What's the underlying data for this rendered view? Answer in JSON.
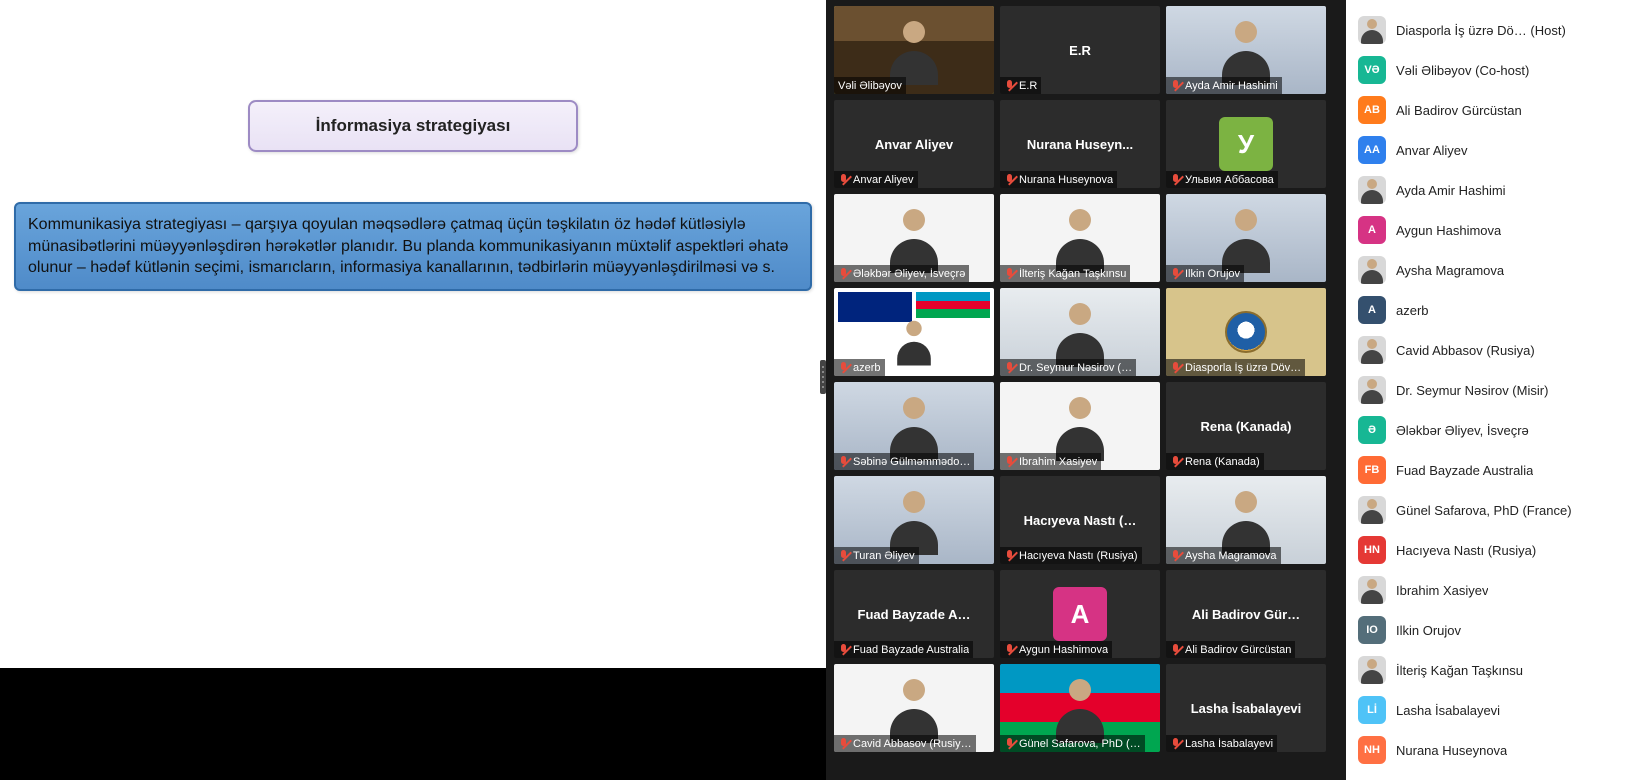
{
  "slide": {
    "title": "İnformasiya strategiyası",
    "body": "Kommunikasiya strategiyası – qarşıya qoyulan məqsədlərə çatmaq üçün təşkilatın öz hədəf kütləsiylə münasibətlərini müəyyənləşdirən hərəkətlər planıdır. Bu planda kommunikasiyanın müxtəlif aspektləri əhatə olunur – hədəf kütlənin seçimi, ismarıcların, informasiya kanallarının, tədbirlərin müəyyənləşdirilməsi və s."
  },
  "tiles": [
    {
      "label": "Vəli Əlibəyov",
      "muted": false,
      "active": true,
      "display": "video",
      "bg": "bg-library"
    },
    {
      "label": "E.R",
      "muted": true,
      "center": "E.R",
      "display": "name"
    },
    {
      "label": "Ayda Amir Hashimi",
      "muted": true,
      "display": "video",
      "bg": "bg-room"
    },
    {
      "label": "Anvar Aliyev",
      "muted": true,
      "center": "Anvar Aliyev",
      "display": "name"
    },
    {
      "label": "Nurana Huseynova",
      "muted": true,
      "center": "Nurana  Huseyn...",
      "display": "name"
    },
    {
      "label": "Ульвия Аббасова",
      "muted": true,
      "display": "avatar",
      "avatar_bg": "#7cb342",
      "avatar_text": "У"
    },
    {
      "label": "Ələkbər Əliyev, İsveçrə",
      "muted": true,
      "display": "video",
      "bg": "bg-white"
    },
    {
      "label": "İlteriş Kağan Taşkınsu",
      "muted": true,
      "display": "video",
      "bg": "bg-white"
    },
    {
      "label": "Ilkin Orujov",
      "muted": true,
      "display": "video",
      "bg": "bg-room"
    },
    {
      "label": "azerb",
      "muted": true,
      "display": "video",
      "bg": "bg-white",
      "flags": true
    },
    {
      "label": "Dr. Seymur Nəsirov (…",
      "muted": true,
      "display": "video",
      "bg": "bg-office"
    },
    {
      "label": "Diasporla İş üzrə Döv…",
      "muted": true,
      "display": "crest"
    },
    {
      "label": "Səbinə Gülməmmədo…",
      "muted": true,
      "display": "video",
      "bg": "bg-room"
    },
    {
      "label": "Ibrahim Xasiyev",
      "muted": true,
      "display": "video",
      "bg": "bg-white"
    },
    {
      "label": "Rena (Kanada)",
      "muted": true,
      "center": "Rena (Kanada)",
      "display": "name"
    },
    {
      "label": "Turan Əliyev",
      "muted": true,
      "display": "video",
      "bg": "bg-room"
    },
    {
      "label": "Hacıyeva Nastı (Rusiya)",
      "muted": true,
      "center": "Hacıyeva  Nastı  (…",
      "display": "name"
    },
    {
      "label": "Aysha Magramova",
      "muted": true,
      "display": "video",
      "bg": "bg-office"
    },
    {
      "label": "Fuad Bayzade Australia",
      "muted": true,
      "center": "Fuad  Bayzade  A…",
      "display": "name"
    },
    {
      "label": "Aygun Hashimova",
      "muted": true,
      "display": "avatar",
      "avatar_bg": "#d63384",
      "avatar_text": "A"
    },
    {
      "label": "Ali Badirov  Gürcüstan",
      "muted": true,
      "center": "Ali Badirov   Gür…",
      "display": "name"
    },
    {
      "label": "Cavid Abbasov (Rusiy…",
      "muted": true,
      "display": "video",
      "bg": "bg-white"
    },
    {
      "label": "Günel Safarova, PhD (…",
      "muted": true,
      "display": "video",
      "bg": "bg-flag"
    },
    {
      "label": "Lasha İsabalayevi",
      "muted": true,
      "center": "Lasha İsabalayevi",
      "display": "name"
    }
  ],
  "participants": [
    {
      "name": "Diasporla İş üzrə Dö… (Host)",
      "avatar_type": "photo"
    },
    {
      "name": "Vəli Əlibəyov (Co-host)",
      "avatar_type": "initials",
      "initials": "VƏ",
      "bg": "#17b794"
    },
    {
      "name": "Ali Badirov  Gürcüstan",
      "avatar_type": "initials",
      "initials": "AB",
      "bg": "#ff7b1c"
    },
    {
      "name": "Anvar Aliyev",
      "avatar_type": "initials",
      "initials": "AA",
      "bg": "#2f80ed"
    },
    {
      "name": "Ayda Amir Hashimi",
      "avatar_type": "photo"
    },
    {
      "name": "Aygun Hashimova",
      "avatar_type": "initials",
      "initials": "A",
      "bg": "#d63384"
    },
    {
      "name": "Aysha Magramova",
      "avatar_type": "photo"
    },
    {
      "name": "azerb",
      "avatar_type": "initials",
      "initials": "A",
      "bg": "#34506e"
    },
    {
      "name": "Cavid Abbasov (Rusiya)",
      "avatar_type": "photo"
    },
    {
      "name": "Dr. Seymur Nəsirov (Misir)",
      "avatar_type": "photo"
    },
    {
      "name": "Ələkbər Əliyev, İsveçrə",
      "avatar_type": "initials",
      "initials": "Ə",
      "bg": "#17b794"
    },
    {
      "name": "Fuad Bayzade Australia",
      "avatar_type": "initials",
      "initials": "FB",
      "bg": "#ff6b35"
    },
    {
      "name": "Günel Safarova, PhD (France)",
      "avatar_type": "photo"
    },
    {
      "name": "Hacıyeva Nastı (Rusiya)",
      "avatar_type": "initials",
      "initials": "HN",
      "bg": "#e53935"
    },
    {
      "name": "Ibrahim Xasiyev",
      "avatar_type": "photo"
    },
    {
      "name": "Ilkin Orujov",
      "avatar_type": "initials",
      "initials": "IO",
      "bg": "#546e7a"
    },
    {
      "name": "İlteriş Kağan Taşkınsu",
      "avatar_type": "photo"
    },
    {
      "name": "Lasha İsabalayevi",
      "avatar_type": "initials",
      "initials": "Lİ",
      "bg": "#4fc3f7"
    },
    {
      "name": "Nurana Huseynova",
      "avatar_type": "initials",
      "initials": "NH",
      "bg": "#ff7043"
    }
  ]
}
